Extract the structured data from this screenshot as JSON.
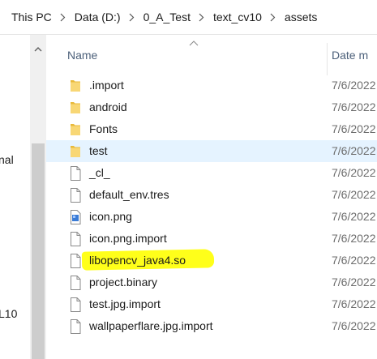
{
  "breadcrumb": {
    "items": [
      "This PC",
      "Data (D:)",
      "0_A_Test",
      "text_cv10",
      "assets"
    ]
  },
  "nav_pane": {
    "visible_fragments": [
      "nal",
      "L10"
    ]
  },
  "columns": {
    "name": "Name",
    "date": "Date m"
  },
  "files": [
    {
      "name": ".import",
      "date": "7/6/2022",
      "type": "folder"
    },
    {
      "name": "android",
      "date": "7/6/2022",
      "type": "folder"
    },
    {
      "name": "Fonts",
      "date": "7/6/2022",
      "type": "folder"
    },
    {
      "name": "test",
      "date": "7/6/2022",
      "type": "folder",
      "selected": true
    },
    {
      "name": "_cl_",
      "date": "7/6/2022",
      "type": "file"
    },
    {
      "name": "default_env.tres",
      "date": "7/6/2022",
      "type": "file"
    },
    {
      "name": "icon.png",
      "date": "7/6/2022",
      "type": "image"
    },
    {
      "name": "icon.png.import",
      "date": "7/6/2022",
      "type": "file"
    },
    {
      "name": "libopencv_java4.so",
      "date": "7/6/2022",
      "type": "file",
      "highlighted": true
    },
    {
      "name": "project.binary",
      "date": "7/6/2022",
      "type": "file"
    },
    {
      "name": "test.jpg.import",
      "date": "7/6/2022",
      "type": "file"
    },
    {
      "name": "wallpaperflare.jpg.import",
      "date": "7/6/2022",
      "type": "file"
    }
  ],
  "colors": {
    "folder": "#f8d775",
    "selected_row": "#e5f3ff",
    "highlight": "#ffff1a",
    "header_text": "#4c607a"
  }
}
